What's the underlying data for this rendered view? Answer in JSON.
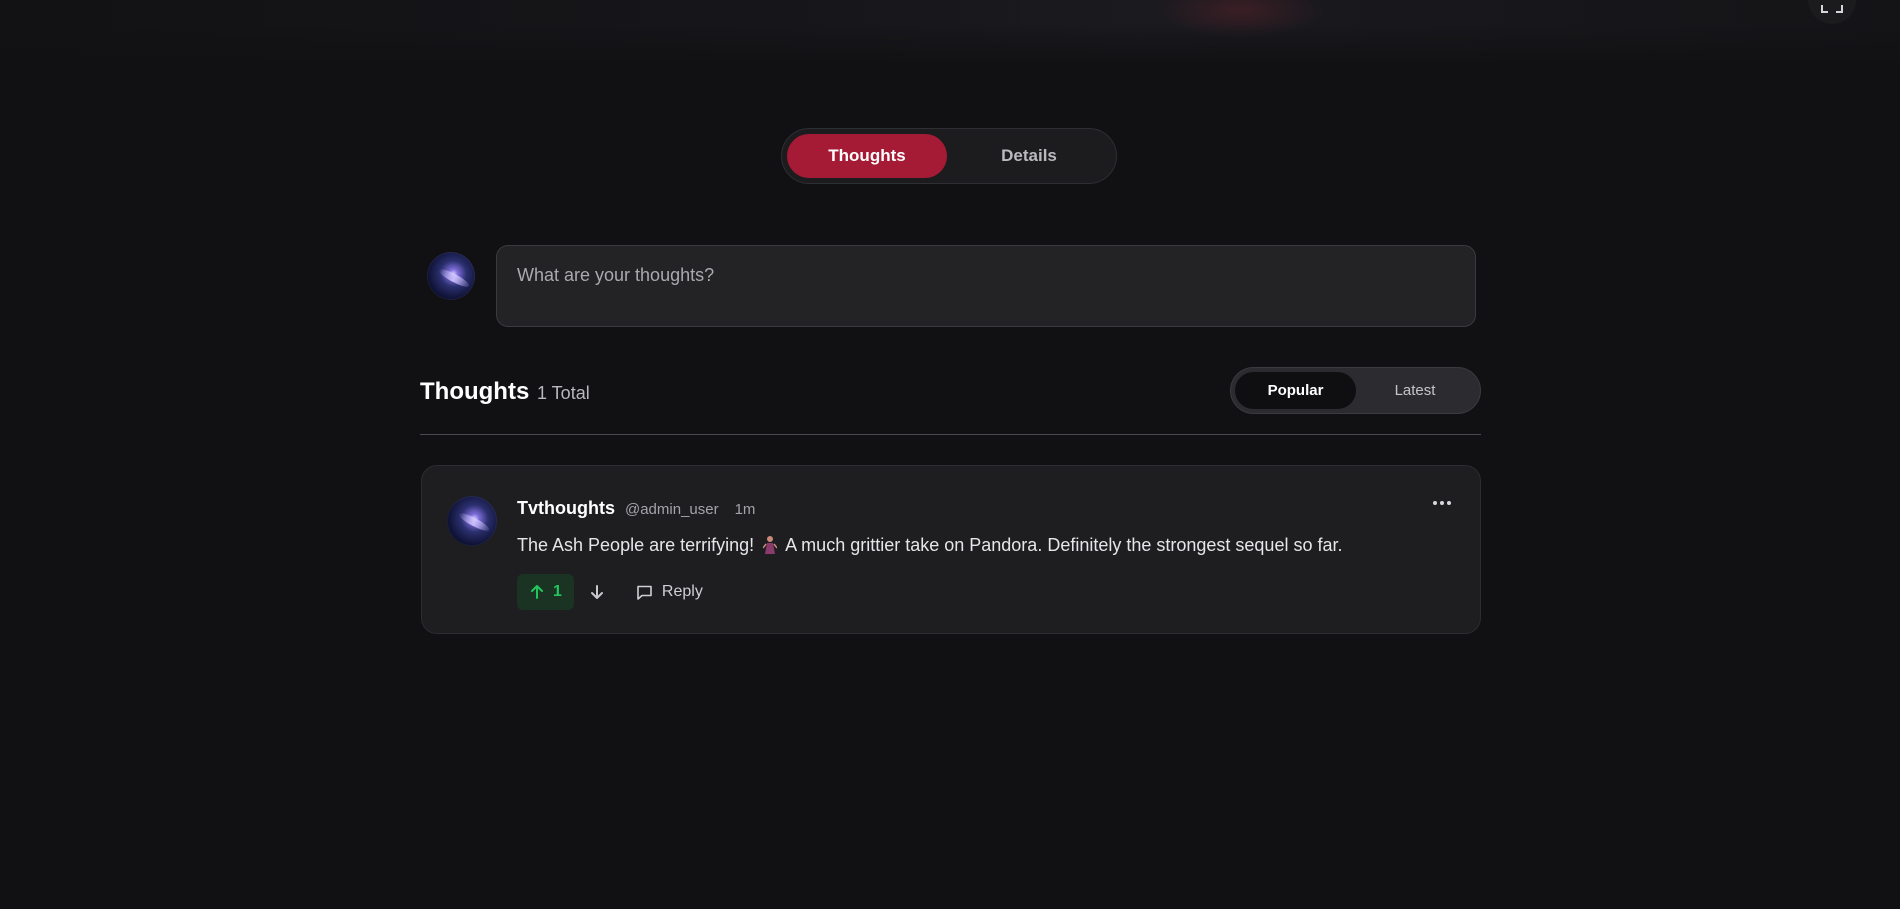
{
  "tabs": {
    "thoughts_label": "Thoughts",
    "details_label": "Details"
  },
  "composer": {
    "placeholder": "What are your thoughts?"
  },
  "thoughts_section": {
    "title": "Thoughts",
    "count_label": "1 Total",
    "sort": {
      "popular_label": "Popular",
      "latest_label": "Latest",
      "selected": "Popular"
    }
  },
  "comments": [
    {
      "author": "Tvthoughts",
      "handle": "@admin_user",
      "time": "1m",
      "text_before_emoji": "The Ash People are terrifying!",
      "emoji": "person-figure-emoji",
      "text_after_emoji": "A much grittier take on Pandora. Definitely the strongest sequel so far.",
      "upvotes": "1",
      "reply_label": "Reply"
    }
  ],
  "colors": {
    "background": "#111113",
    "accent": "#a51b35",
    "upvote_green": "#22c55e",
    "card": "#1e1e21"
  },
  "icons": [
    "fullscreen-icon",
    "more-icon",
    "arrow-up-icon",
    "arrow-down-icon",
    "chat-bubble-icon"
  ]
}
